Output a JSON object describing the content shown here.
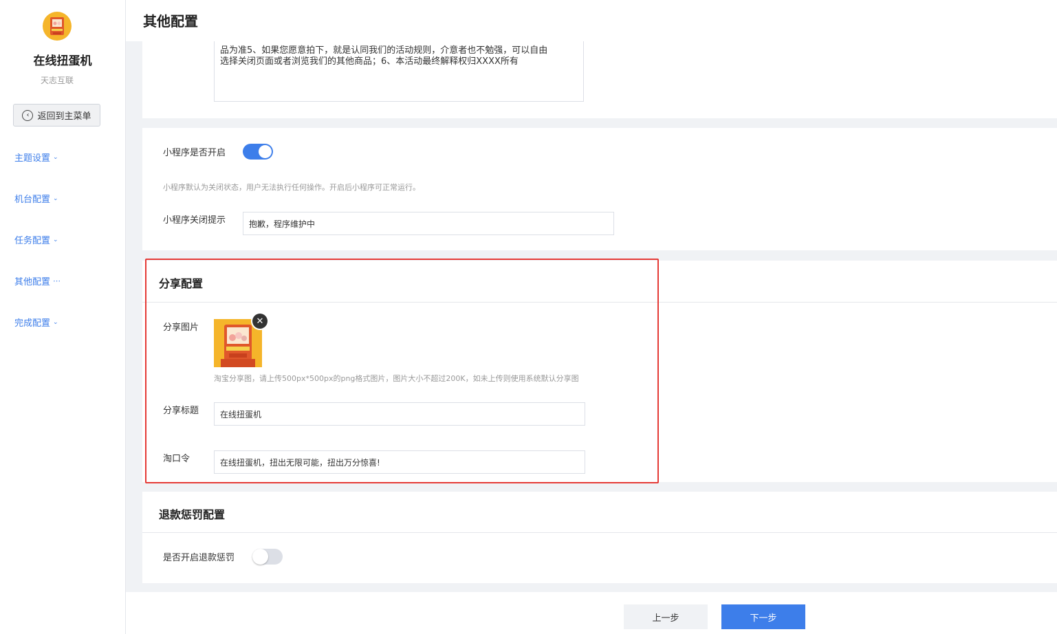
{
  "sidebar": {
    "app_name": "在线扭蛋机",
    "app_subtitle": "天志互联",
    "back_label": "返回到主菜单",
    "items": [
      {
        "label": "主题设置",
        "state": "collapsed"
      },
      {
        "label": "机台配置",
        "state": "collapsed"
      },
      {
        "label": "任务配置",
        "state": "collapsed"
      },
      {
        "label": "其他配置",
        "state": "active"
      },
      {
        "label": "完成配置",
        "state": "collapsed"
      }
    ]
  },
  "header": {
    "title": "其他配置"
  },
  "rules_text": {
    "line1": "品为准5、如果您愿意拍下，就是认同我们的活动规则，介意者也不勉强，可以自由",
    "line2": "选择关闭页面或者浏览我们的其他商品；6、本活动最终解释权归XXXX所有"
  },
  "miniprogram": {
    "open_label": "小程序是否开启",
    "open_state": true,
    "hint": "小程序默认为关闭状态，用户无法执行任何操作。开启后小程序可正常运行。",
    "close_tip_label": "小程序关闭提示",
    "close_tip_value": "抱歉，程序维护中"
  },
  "share": {
    "title": "分享配置",
    "image_label": "分享图片",
    "image_hint": "淘宝分享图，请上传500px*500px的png格式图片，图片大小不超过200K，如未上传则使用系统默认分享图",
    "share_title_label": "分享标题",
    "share_title_value": "在线扭蛋机",
    "taokouling_label": "淘口令",
    "taokouling_value": "在线扭蛋机，扭出无限可能，扭出万分惊喜!"
  },
  "refund": {
    "title": "退款惩罚配置",
    "enable_label": "是否开启退款惩罚",
    "enable_state": false
  },
  "footer": {
    "prev_label": "上一步",
    "next_label": "下一步"
  },
  "colors": {
    "accent": "#3d7eea",
    "highlight": "#e53935",
    "logo_bg": "#f5b52a"
  }
}
